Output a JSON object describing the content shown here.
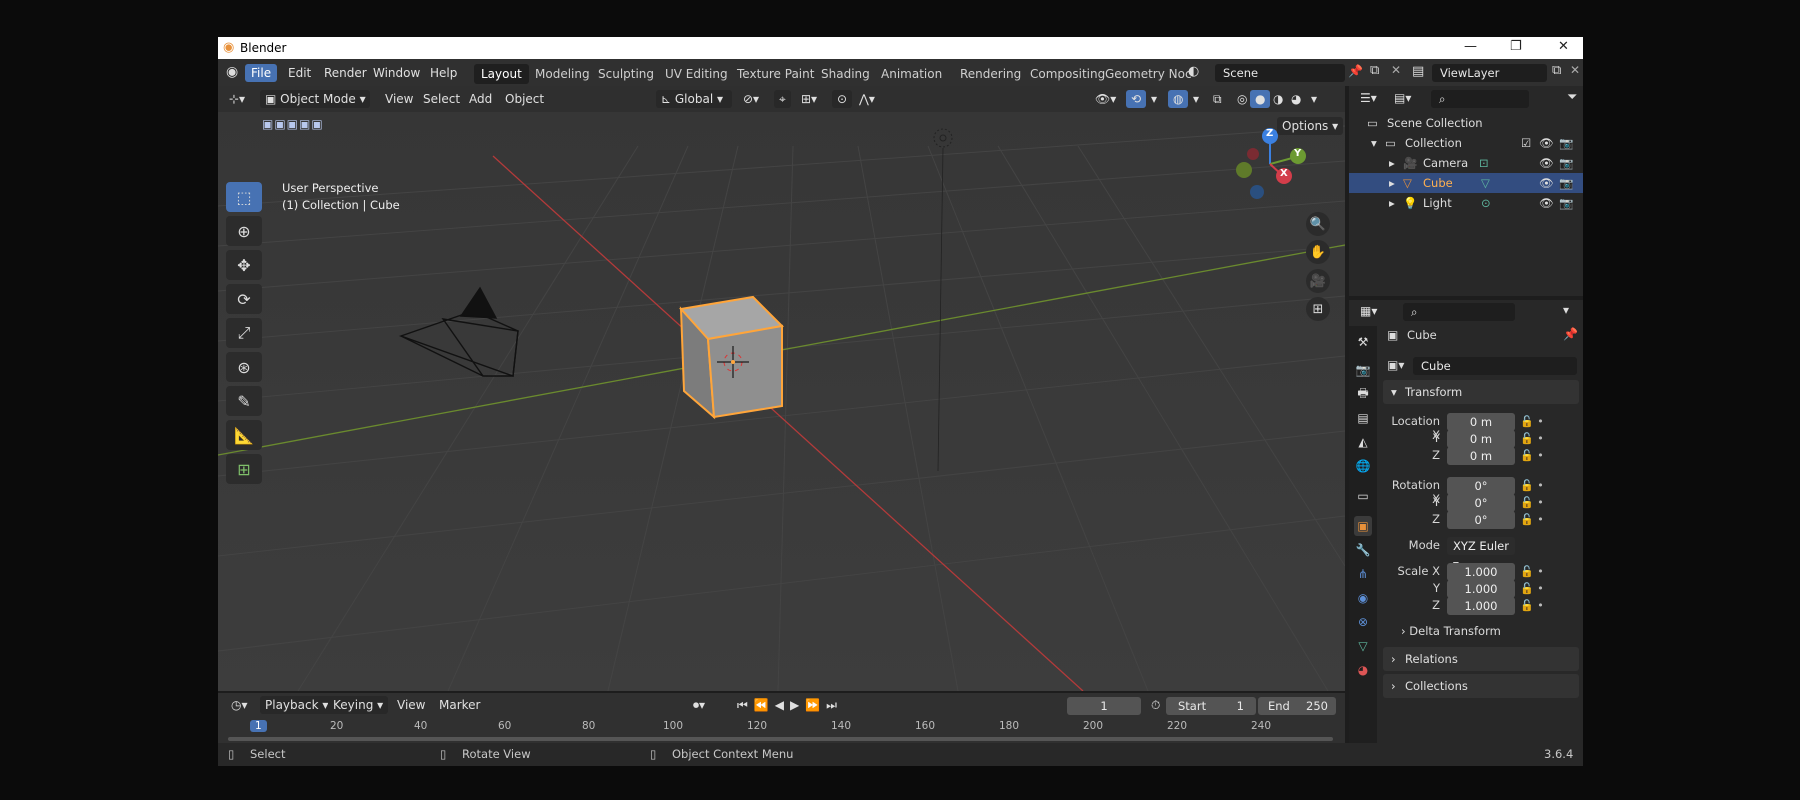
{
  "window": {
    "title": "Blender"
  },
  "menu": {
    "items": [
      "File",
      "Edit",
      "Render",
      "Window",
      "Help"
    ],
    "active": "File"
  },
  "workspaces": [
    "Layout",
    "Modeling",
    "Sculpting",
    "UV Editing",
    "Texture Paint",
    "Shading",
    "Animation",
    "Rendering",
    "Compositing",
    "Geometry Noc"
  ],
  "scene": {
    "name": "Scene",
    "view_layer": "ViewLayer"
  },
  "viewport": {
    "mode": "Object Mode",
    "menus": [
      "View",
      "Select",
      "Add",
      "Object"
    ],
    "orientation": "Global",
    "options_label": "Options",
    "overlay_line1": "User Perspective",
    "overlay_line2": "(1) Collection | Cube",
    "gizmo": {
      "x": "X",
      "y": "Y",
      "z": "Z"
    }
  },
  "timeline": {
    "menus": [
      "Playback",
      "Keying",
      "View",
      "Marker"
    ],
    "current_frame": "1",
    "start_label": "Start",
    "start": "1",
    "end_label": "End",
    "end": "250",
    "ruler": [
      "1",
      "20",
      "40",
      "60",
      "80",
      "100",
      "120",
      "140",
      "160",
      "180",
      "200",
      "220",
      "240"
    ]
  },
  "status": {
    "select": "Select",
    "rotate": "Rotate View",
    "context": "Object Context Menu",
    "version": "3.6.4"
  },
  "outliner": {
    "root": "Scene Collection",
    "collection": "Collection",
    "items": [
      {
        "name": "Camera",
        "color": "#e8913a"
      },
      {
        "name": "Cube",
        "color": "#e8913a",
        "selected": true
      },
      {
        "name": "Light",
        "color": "#e8913a"
      }
    ]
  },
  "properties": {
    "object_name": "Cube",
    "data_name": "Cube",
    "transform_label": "Transform",
    "location_label": "Location X",
    "location": [
      "0 m",
      "0 m",
      "0 m"
    ],
    "rotation_label": "Rotation X",
    "rotation": [
      "0°",
      "0°",
      "0°"
    ],
    "mode_label": "Mode",
    "mode_value": "XYZ Euler",
    "scale_label": "Scale X",
    "scale": [
      "1.000",
      "1.000",
      "1.000"
    ],
    "axis_y": "Y",
    "axis_z": "Z",
    "delta_label": "Delta Transform",
    "relations_label": "Relations",
    "collections_label": "Collections"
  },
  "colors": {
    "accent": "#4772b3",
    "selection": "#ffa53a",
    "x_axis": "#a33a3a",
    "y_axis": "#6c8a2e"
  }
}
